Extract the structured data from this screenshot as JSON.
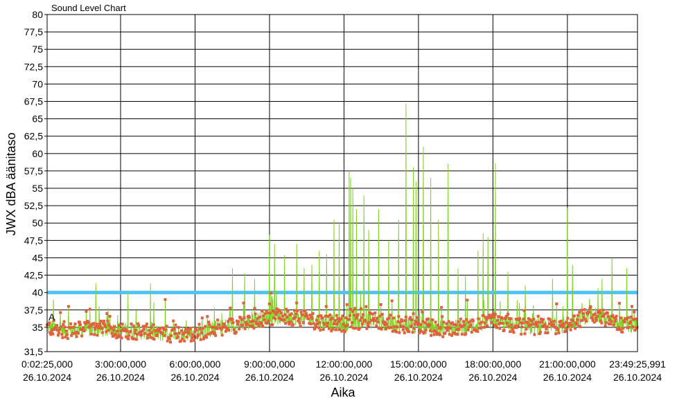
{
  "chart_data": {
    "type": "line",
    "title": "Sound Level Chart",
    "xlabel": "Aika",
    "ylabel": "JWX dBA äänitaso",
    "ylim": [
      31.5,
      80
    ],
    "yticks": [
      "31,5",
      "35",
      "37,5",
      "40",
      "42,5",
      "45",
      "47,5",
      "50",
      "52,5",
      "55",
      "57,5",
      "60",
      "62,5",
      "65",
      "67,5",
      "70",
      "72,5",
      "75",
      "77,5",
      "80"
    ],
    "xlim_hours": [
      0.0403,
      23.824
    ],
    "xticks": [
      {
        "hours": 0.0403,
        "time": "0:02:25,000",
        "date": "26.10.2024"
      },
      {
        "hours": 3,
        "time": "3:00:00,000",
        "date": "26.10.2024"
      },
      {
        "hours": 6,
        "time": "6:00:00,000",
        "date": "26.10.2024"
      },
      {
        "hours": 9,
        "time": "9:00:00,000",
        "date": "26.10.2024"
      },
      {
        "hours": 12,
        "time": "12:00:00,000",
        "date": "26.10.2024"
      },
      {
        "hours": 15,
        "time": "15:00:00,000",
        "date": "26.10.2024"
      },
      {
        "hours": 18,
        "time": "18:00:00,000",
        "date": "26.10.2024"
      },
      {
        "hours": 21,
        "time": "21:00:00,000",
        "date": "26.10.2024"
      },
      {
        "hours": 23.824,
        "time": "23:49:25,991",
        "date": "26.10.2024"
      }
    ],
    "limit_line": {
      "value": 40,
      "color": "#4fc3f7"
    },
    "marker_label": {
      "text": "A",
      "y": 36
    },
    "grid": true,
    "series": [
      {
        "color": "#7ed321",
        "marker_color": "#e06040",
        "base_levels": [
          [
            0,
            35
          ],
          [
            1,
            34.5
          ],
          [
            2,
            34.8
          ],
          [
            3,
            34.6
          ],
          [
            4,
            34.3
          ],
          [
            5,
            34.0
          ],
          [
            6,
            34.2
          ],
          [
            7,
            35.0
          ],
          [
            8,
            35.5
          ],
          [
            9,
            36.5
          ],
          [
            10,
            36.5
          ],
          [
            11,
            35.8
          ],
          [
            12,
            35.5
          ],
          [
            13,
            36.0
          ],
          [
            14,
            35.5
          ],
          [
            15,
            35.2
          ],
          [
            16,
            34.8
          ],
          [
            17,
            35.2
          ],
          [
            18,
            35.8
          ],
          [
            19,
            35.2
          ],
          [
            20,
            35.0
          ],
          [
            21,
            35.4
          ],
          [
            22,
            37.0
          ],
          [
            23,
            35.5
          ],
          [
            23.824,
            35.2
          ]
        ],
        "peaks": [
          [
            0.3,
            39.0
          ],
          [
            0.9,
            38.0
          ],
          [
            2.0,
            41.3
          ],
          [
            3.3,
            40.0
          ],
          [
            4.2,
            41.3
          ],
          [
            4.8,
            39.0
          ],
          [
            7.5,
            43.5
          ],
          [
            8.0,
            42.8
          ],
          [
            8.4,
            42.0
          ],
          [
            9.0,
            48.3
          ],
          [
            9.2,
            47.0
          ],
          [
            9.6,
            45.3
          ],
          [
            10.1,
            47.0
          ],
          [
            10.4,
            43.5
          ],
          [
            10.7,
            44.0
          ],
          [
            11.0,
            46.0
          ],
          [
            11.3,
            45.5
          ],
          [
            11.6,
            50.5
          ],
          [
            11.8,
            50.0
          ],
          [
            12.5,
            52.0
          ],
          [
            12.8,
            54.0
          ],
          [
            13.0,
            49.0
          ],
          [
            13.4,
            52.0
          ],
          [
            13.8,
            47.5
          ],
          [
            14.2,
            50.5
          ],
          [
            14.5,
            67.2
          ],
          [
            14.8,
            58.0
          ],
          [
            14.9,
            56.0
          ],
          [
            15.2,
            61.0
          ],
          [
            15.5,
            56.5
          ],
          [
            15.8,
            50.5
          ],
          [
            16.2,
            58.5
          ],
          [
            16.6,
            43.5
          ],
          [
            16.9,
            42.5
          ],
          [
            17.4,
            46.0
          ],
          [
            17.6,
            48.5
          ],
          [
            17.8,
            48.0
          ],
          [
            18.1,
            58.6
          ],
          [
            18.6,
            43.0
          ],
          [
            19.3,
            41.0
          ],
          [
            20.4,
            42.0
          ],
          [
            21.0,
            52.2
          ],
          [
            21.2,
            44.0
          ],
          [
            21.6,
            38.5
          ],
          [
            22.4,
            42.0
          ],
          [
            22.8,
            45.0
          ],
          [
            23.4,
            43.5
          ],
          [
            23.6,
            38.0
          ]
        ],
        "cluster_peaks": [
          [
            12.2,
            57.5
          ],
          [
            12.27,
            56.5
          ],
          [
            12.35,
            55.0
          ]
        ]
      }
    ]
  }
}
